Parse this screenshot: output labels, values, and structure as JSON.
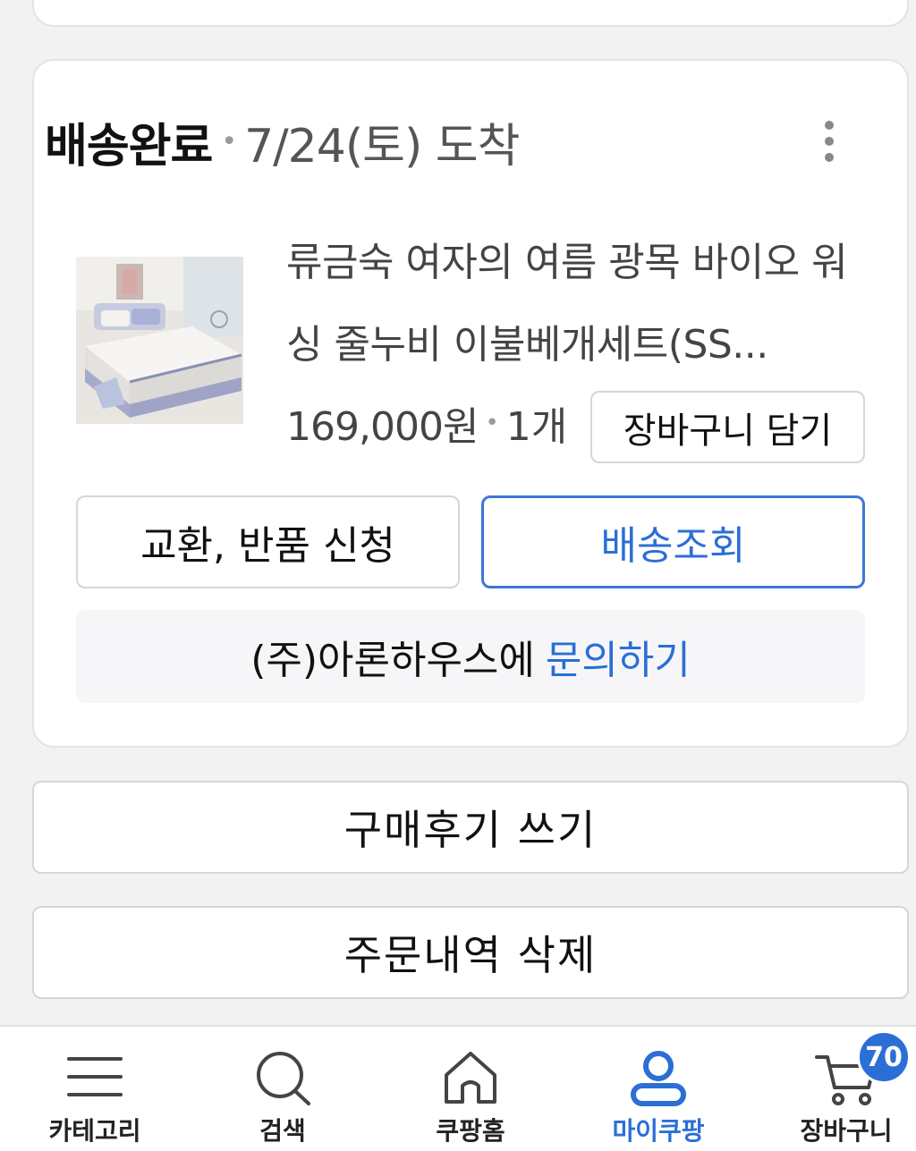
{
  "order": {
    "status": "배송완료",
    "delivery_date": "7/24(토) 도착",
    "product": {
      "name": "류금숙 여자의 여름 광목 바이오 워싱 줄누비 이불베개세트(SS...",
      "price": "169,000원",
      "quantity": "1개",
      "image_alt": "bedding set product photo"
    },
    "add_to_cart_label": "장바구니 담기",
    "exchange_return_label": "교환, 반품 신청",
    "track_delivery_label": "배송조회",
    "seller_inquiry_prefix": "(주)아론하우스에",
    "seller_inquiry_link": "문의하기"
  },
  "actions": {
    "write_review_label": "구매후기 쓰기",
    "delete_order_label": "주문내역 삭제"
  },
  "bottom_nav": {
    "items": [
      {
        "label": "카테고리",
        "icon": "menu-icon"
      },
      {
        "label": "검색",
        "icon": "search-icon"
      },
      {
        "label": "쿠팡홈",
        "icon": "home-icon"
      },
      {
        "label": "마이쿠팡",
        "icon": "person-icon"
      },
      {
        "label": "장바구니",
        "icon": "cart-icon"
      }
    ],
    "active_index": 3,
    "cart_badge": "70"
  },
  "colors": {
    "accent": "#2b6fd6",
    "background": "#f2f2f2",
    "border": "#d6d6d6"
  }
}
